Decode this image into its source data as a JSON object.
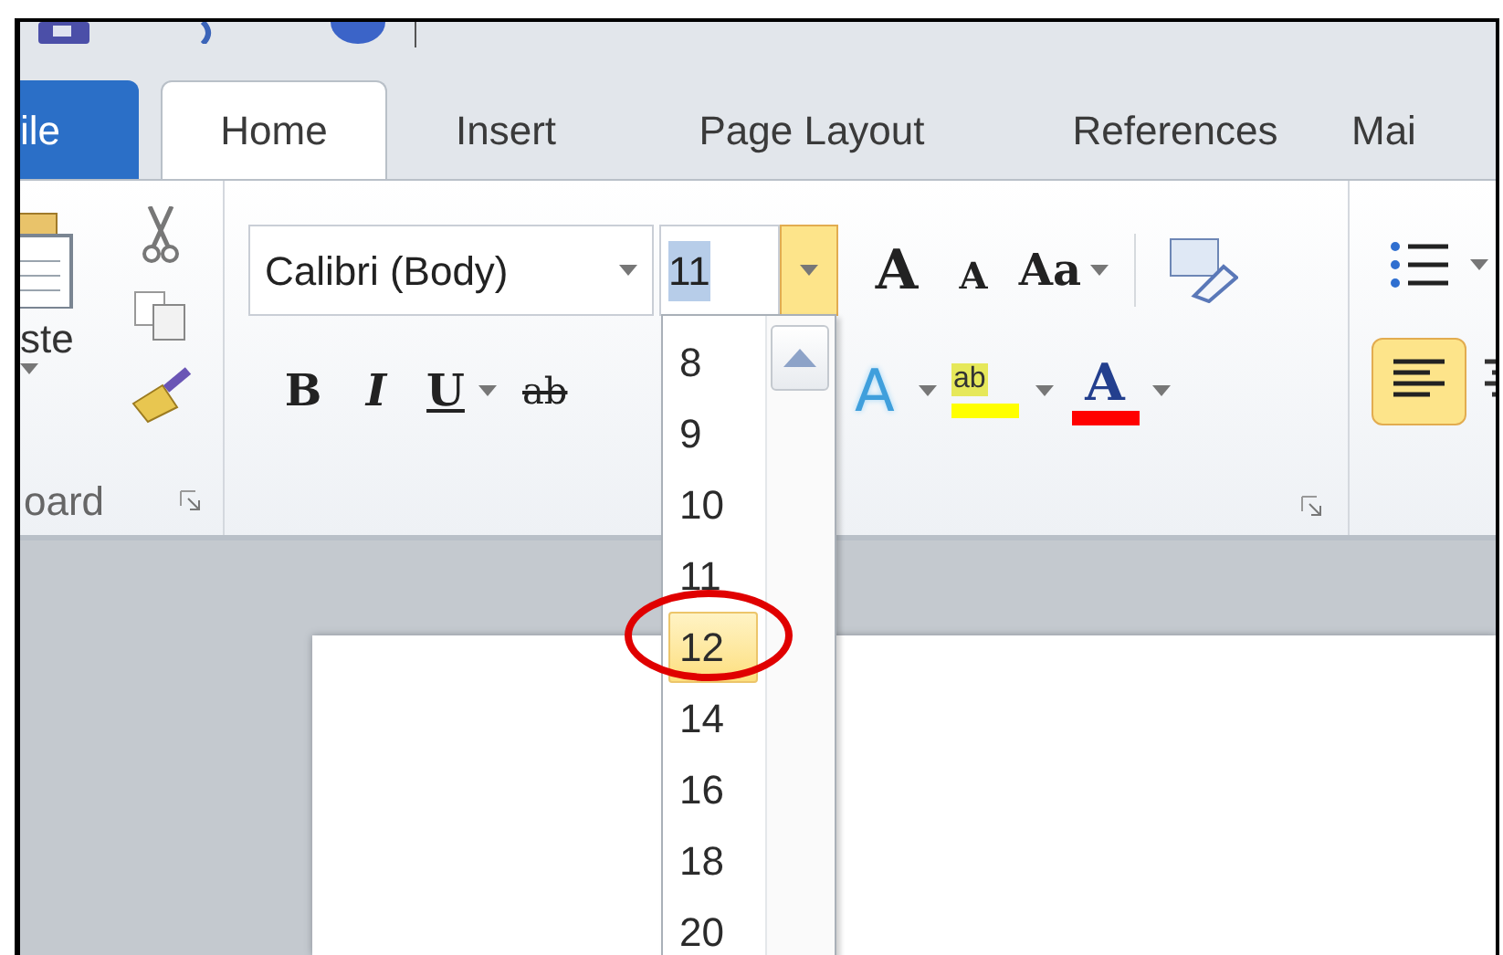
{
  "tabs": [
    {
      "label": "ile",
      "kind": "file",
      "selected": false
    },
    {
      "label": "Home",
      "kind": "tab",
      "selected": true
    },
    {
      "label": "Insert",
      "kind": "tab",
      "selected": false
    },
    {
      "label": "Page Layout",
      "kind": "tab",
      "selected": false
    },
    {
      "label": "References",
      "kind": "tab",
      "selected": false
    },
    {
      "label": "Mai",
      "kind": "tab",
      "selected": false
    }
  ],
  "clipboard": {
    "paste_label": "ste",
    "group_label": "oard"
  },
  "font_group": {
    "font_name": "Calibri (Body)",
    "font_size": "11",
    "size_menu_open": true,
    "row1": [
      {
        "kind": "grow",
        "label": "A"
      },
      {
        "kind": "shrink",
        "label": "A"
      },
      {
        "kind": "case",
        "label": "Aa"
      }
    ],
    "row2": [
      {
        "kind": "bold",
        "label": "B"
      },
      {
        "kind": "italic",
        "label": "I"
      },
      {
        "kind": "underline",
        "label": "U"
      },
      {
        "kind": "strike",
        "label": "ab"
      }
    ],
    "row2_right": [
      {
        "kind": "effects",
        "label": "A"
      },
      {
        "kind": "highlight",
        "label": "ab"
      },
      {
        "kind": "color",
        "label": "A"
      }
    ]
  },
  "size_menu": [
    {
      "label": "8",
      "selected": false
    },
    {
      "label": "9",
      "selected": false
    },
    {
      "label": "10",
      "selected": false
    },
    {
      "label": "11",
      "selected": false
    },
    {
      "label": "12",
      "selected": true
    },
    {
      "label": "14",
      "selected": false
    },
    {
      "label": "16",
      "selected": false
    },
    {
      "label": "18",
      "selected": false
    },
    {
      "label": "20",
      "selected": false
    }
  ],
  "paragraph": {
    "align_left_active": true
  }
}
